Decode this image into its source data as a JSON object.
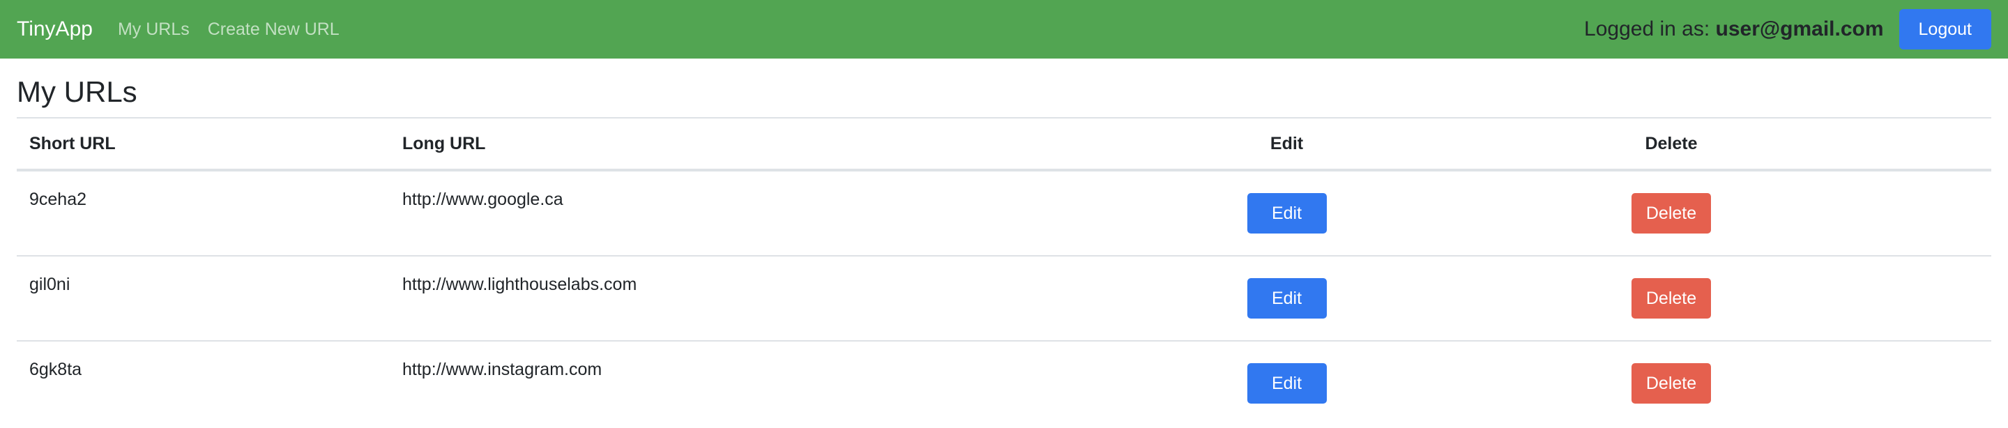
{
  "nav": {
    "brand": "TinyApp",
    "links": [
      "My URLs",
      "Create New URL"
    ],
    "logged_in_prefix": "Logged in as: ",
    "user_email": "user@gmail.com",
    "logout_label": "Logout"
  },
  "colors": {
    "navbar_bg": "#52a552",
    "primary": "#3178f0",
    "danger": "#e5604e"
  },
  "page": {
    "title": "My URLs"
  },
  "table": {
    "headers": [
      "Short URL",
      "Long URL",
      "Edit",
      "Delete"
    ],
    "rows": [
      {
        "short": "9ceha2",
        "long": "http://www.google.ca",
        "edit": "Edit",
        "delete": "Delete"
      },
      {
        "short": "gil0ni",
        "long": "http://www.lighthouselabs.com",
        "edit": "Edit",
        "delete": "Delete"
      },
      {
        "short": "6gk8ta",
        "long": "http://www.instagram.com",
        "edit": "Edit",
        "delete": "Delete"
      }
    ]
  }
}
